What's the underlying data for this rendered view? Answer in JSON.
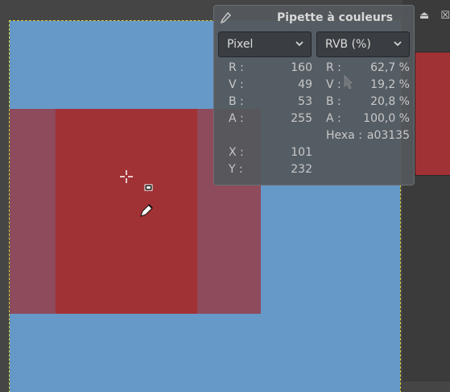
{
  "picker": {
    "title": "Pipette à couleurs",
    "icon": "eyedropper-icon",
    "left_mode": "Pixel",
    "right_mode": "RVB (%)",
    "pixel_rows": [
      {
        "label": "R :",
        "value": "160"
      },
      {
        "label": "V :",
        "value": "49"
      },
      {
        "label": "B :",
        "value": "53"
      },
      {
        "label": "A :",
        "value": "255"
      }
    ],
    "percent_rows": [
      {
        "label": "R :",
        "value": "62,7 %"
      },
      {
        "label": "V :",
        "value": "19,2 %"
      },
      {
        "label": "B :",
        "value": "20,8 %"
      },
      {
        "label": "A :",
        "value": "100,0 %"
      },
      {
        "label": "Hexa :",
        "value": "a03135"
      }
    ],
    "position_rows": [
      {
        "label": "X :",
        "value": "101"
      },
      {
        "label": "Y :",
        "value": "232"
      }
    ]
  },
  "colors": {
    "canvas_bg": "#6699c8",
    "picked": "#a03135",
    "selection_tint": "#8e4b5c",
    "workspace": "#454545"
  },
  "top_right_icons": [
    "eject-icon",
    "close-icon"
  ]
}
